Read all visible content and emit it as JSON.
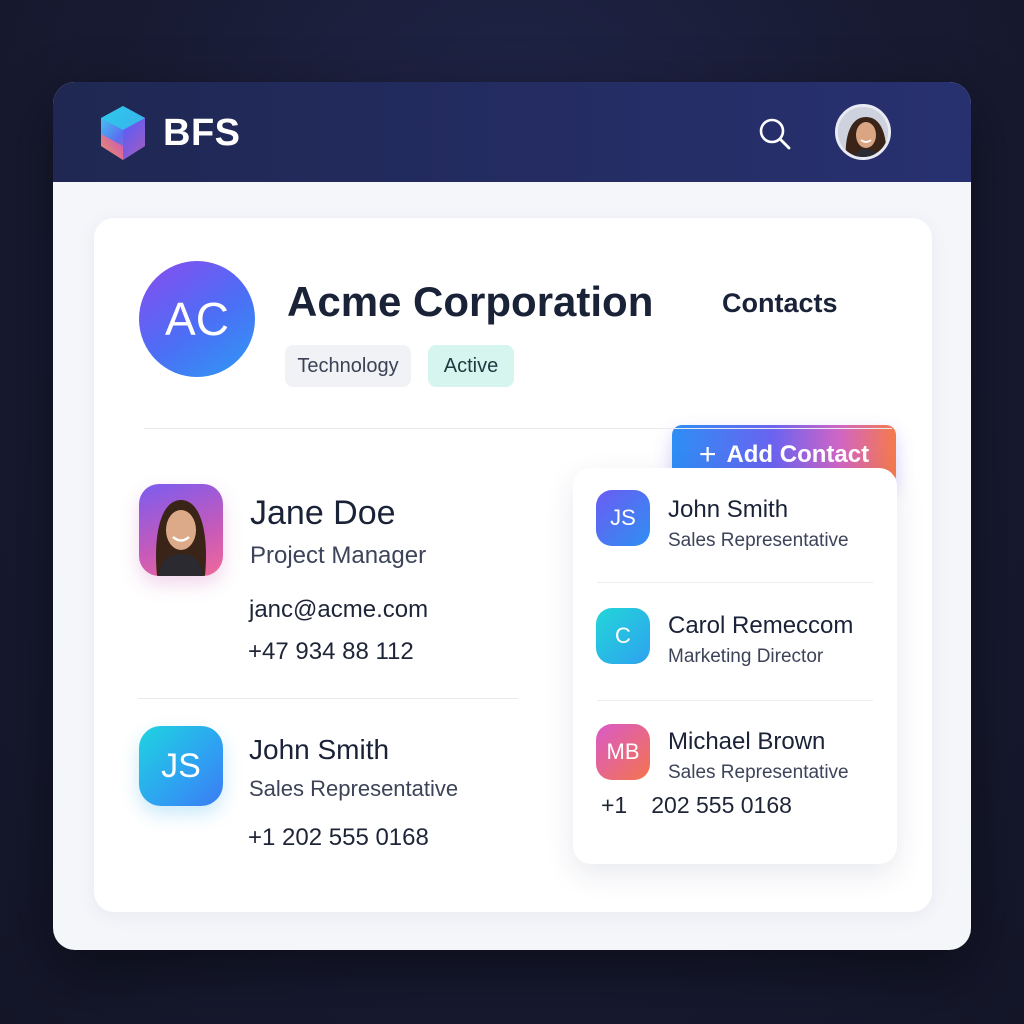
{
  "header": {
    "brand": "BFS",
    "logo_icon": "hexagon-logo-icon",
    "search_icon": "search-icon"
  },
  "company": {
    "initials": "AC",
    "name": "Acme Corporation",
    "industry": "Technology",
    "status": "Active"
  },
  "contacts_section": {
    "title": "Contacts",
    "add_button_label": "Add Contact",
    "add_button_icon": "+"
  },
  "lead_contact": {
    "name": "Jane Doe",
    "role": "Project Manager",
    "email": "janc@acme.com",
    "phone": "+47 934 88 112"
  },
  "secondary_contact": {
    "initials": "JS",
    "name": "John Smith",
    "role": "Sales Representative",
    "phone": "+1 202 555 0168"
  },
  "contact_list": [
    {
      "initials": "JS",
      "name": "John Smith",
      "role": "Sales Representative"
    },
    {
      "initials": "C",
      "name": "Carol Remeccom",
      "role": "Marketing Director"
    },
    {
      "initials": "MB",
      "name": "Michael Brown",
      "role": "Sales Representative"
    }
  ],
  "contact_list_phone": {
    "country_code": "+1",
    "number": "202 555 0168"
  },
  "colors": {
    "header_bg": "#232b60",
    "accent_gradient": [
      "#2d8ef5",
      "#6a63f0",
      "#d165c4",
      "#f57a4a"
    ],
    "status_active_bg": "#d6f5ef"
  }
}
